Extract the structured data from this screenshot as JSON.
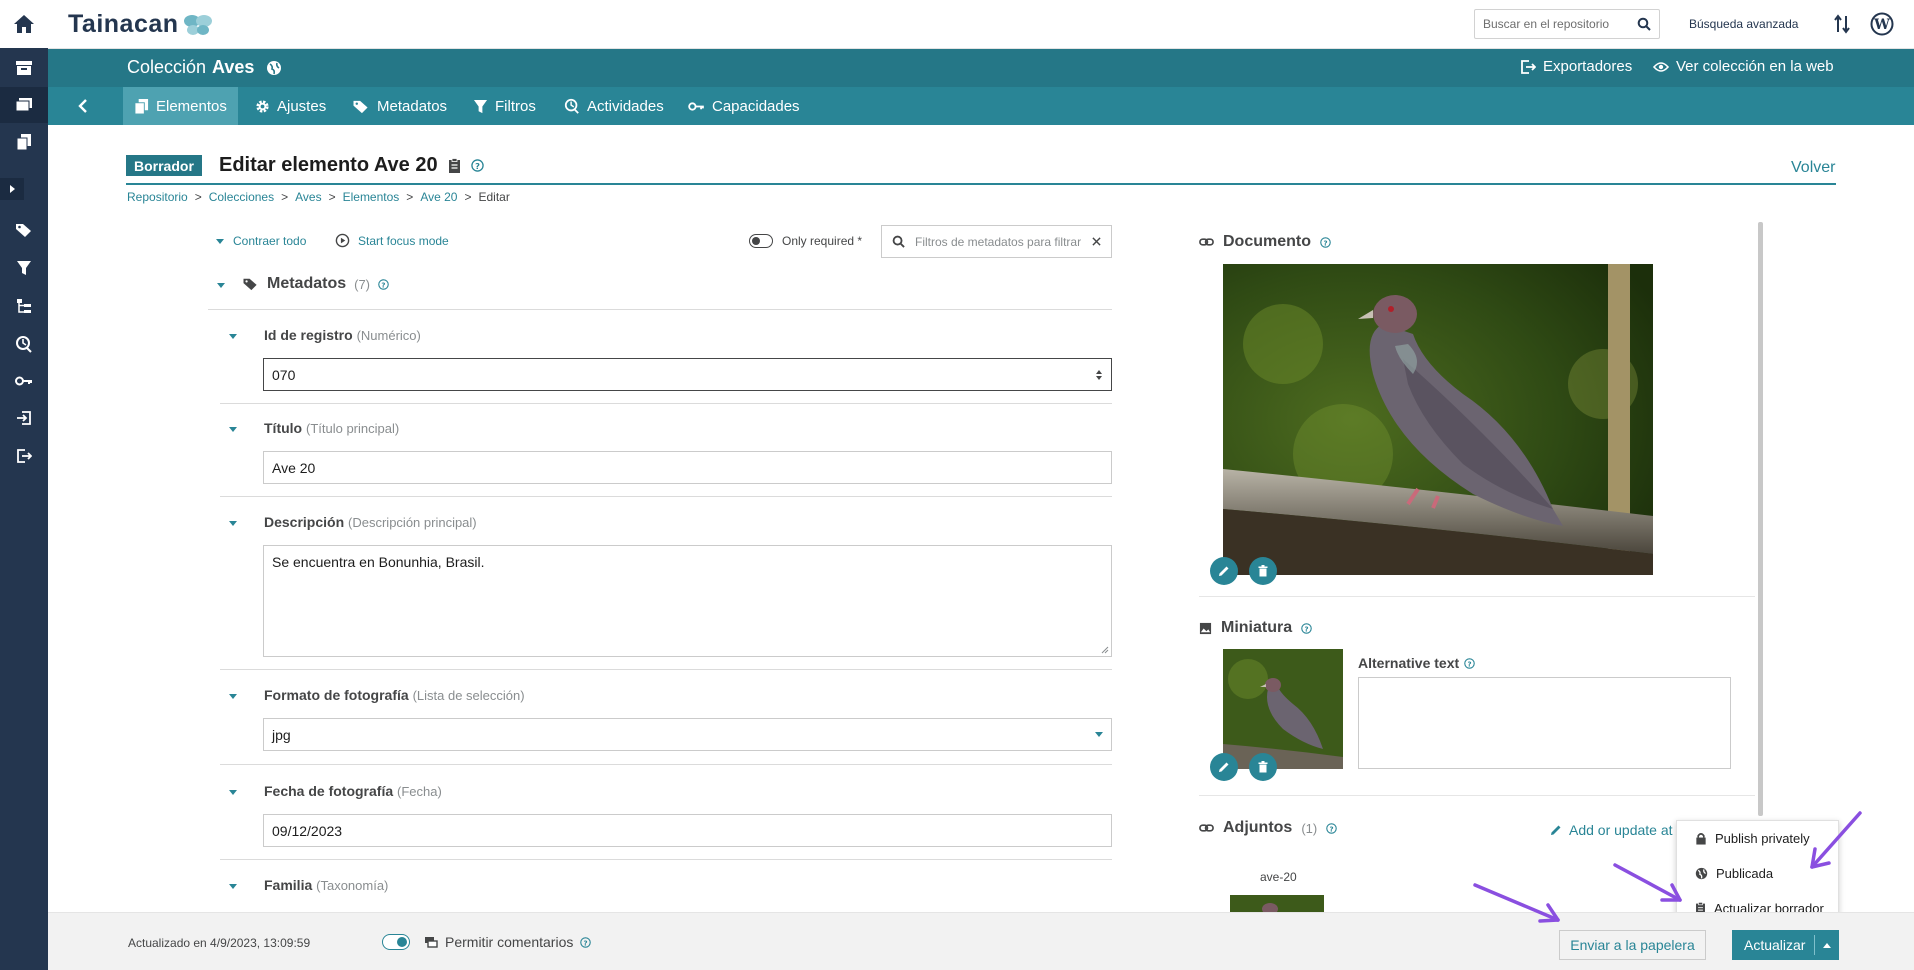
{
  "brand": {
    "name": "Tainacan"
  },
  "topbar": {
    "search_placeholder": "Buscar en el repositorio",
    "advanced_search": "Búsqueda avanzada"
  },
  "collection": {
    "prefix": "Colección",
    "name": "Aves",
    "exporters": "Exportadores",
    "view_web": "Ver colección en la web"
  },
  "tabs": [
    {
      "label": "Elementos",
      "icon": "items-icon",
      "active": true
    },
    {
      "label": "Ajustes",
      "icon": "gear-icon"
    },
    {
      "label": "Metadatos",
      "icon": "tags-icon"
    },
    {
      "label": "Filtros",
      "icon": "filter-icon"
    },
    {
      "label": "Actividades",
      "icon": "activities-icon"
    },
    {
      "label": "Capacidades",
      "icon": "key-icon"
    }
  ],
  "page": {
    "status_badge": "Borrador",
    "title": "Editar elemento Ave 20",
    "back": "Volver"
  },
  "breadcrumb": [
    "Repositorio",
    "Colecciones",
    "Aves",
    "Elementos",
    "Ave 20",
    "Editar"
  ],
  "toolbar": {
    "collapse_all": "Contraer todo",
    "focus_mode": "Start focus mode",
    "only_required": "Only required *",
    "filter_placeholder": "Filtros de metadatos para filtrar"
  },
  "metadata_section": {
    "title": "Metadatos",
    "count": "(7)"
  },
  "fields": [
    {
      "label": "Id de registro",
      "type": "(Numérico)",
      "value": "070"
    },
    {
      "label": "Título",
      "type": "(Título principal)",
      "value": "Ave 20"
    },
    {
      "label": "Descripción",
      "type": "(Descripción principal)",
      "value": "Se encuentra en Bonunhia, Brasil."
    },
    {
      "label": "Formato de fotografía",
      "type": "(Lista de selección)",
      "value": "jpg"
    },
    {
      "label": "Fecha de fotografía",
      "type": "(Fecha)",
      "value": "09/12/2023"
    },
    {
      "label": "Familia",
      "type": "(Taxonomía)",
      "value": ""
    }
  ],
  "document": {
    "title": "Documento"
  },
  "thumbnail": {
    "title": "Miniatura",
    "alt_label": "Alternative text"
  },
  "attachments": {
    "title": "Adjuntos",
    "count": "(1)",
    "add_label": "Add or update at",
    "item_name": "ave-20"
  },
  "dropdown": {
    "items": [
      {
        "label": "Publish privately",
        "icon": "lock-icon"
      },
      {
        "label": "Publicada",
        "icon": "globe-icon"
      },
      {
        "label": "Actualizar borrador",
        "icon": "clipboard-icon"
      }
    ]
  },
  "footer": {
    "updated": "Actualizado en 4/9/2023, 13:09:59",
    "allow_comments": "Permitir comentarios",
    "trash": "Enviar a la papelera",
    "update": "Actualizar"
  },
  "colors": {
    "teal": "#298596",
    "dark_teal": "#257787",
    "sidebar": "#24364f",
    "arrow": "#8a4fe0"
  }
}
